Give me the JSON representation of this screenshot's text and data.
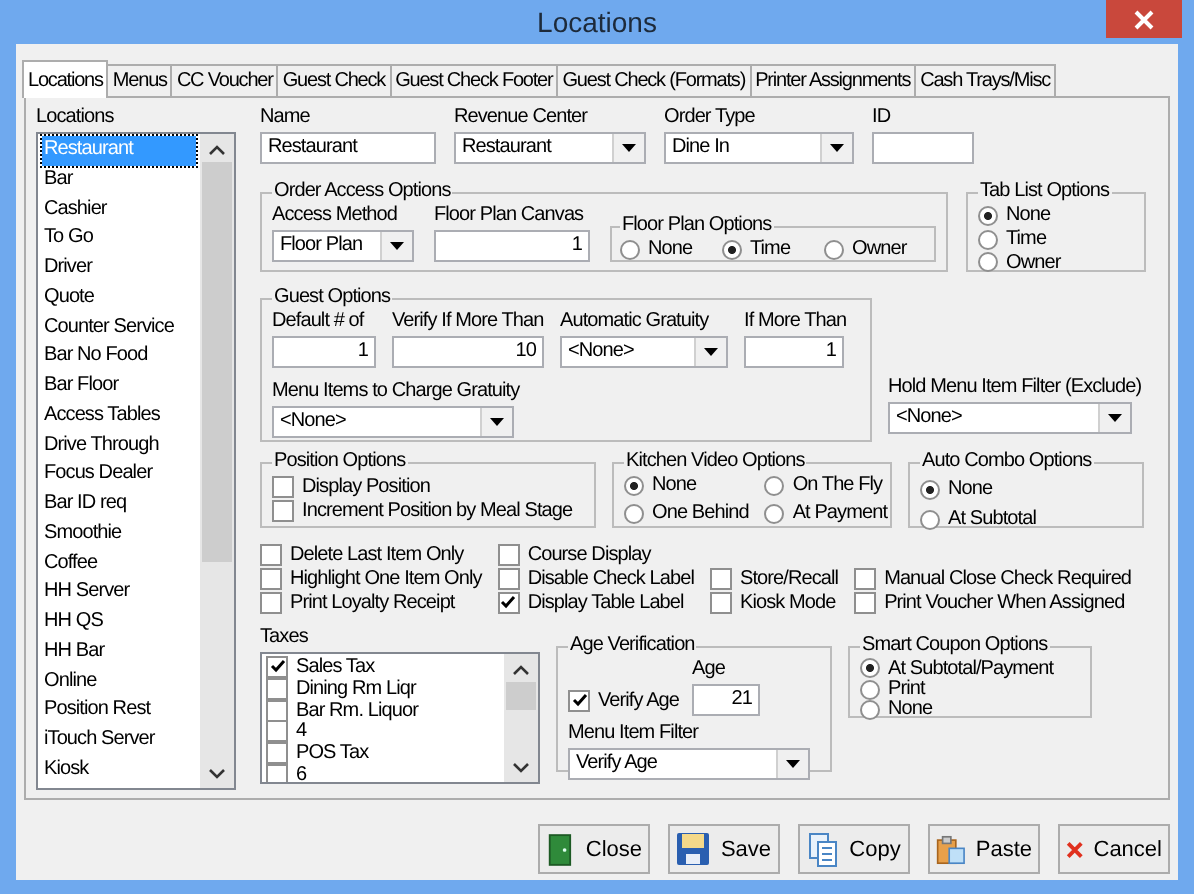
{
  "window": {
    "title": "Locations"
  },
  "tabs": [
    {
      "label": "Locations",
      "selected": true
    },
    {
      "label": "Menus",
      "selected": false
    },
    {
      "label": "CC Voucher",
      "selected": false
    },
    {
      "label": "Guest Check",
      "selected": false
    },
    {
      "label": "Guest Check Footer",
      "selected": false
    },
    {
      "label": "Guest Check (Formats)",
      "selected": false
    },
    {
      "label": "Printer Assignments",
      "selected": false
    },
    {
      "label": "Cash Trays/Misc",
      "selected": false
    }
  ],
  "locations": {
    "label": "Locations",
    "items": [
      {
        "label": "Restaurant",
        "selected": true
      },
      {
        "label": "Bar",
        "selected": false
      },
      {
        "label": "Cashier",
        "selected": false
      },
      {
        "label": "To Go",
        "selected": false
      },
      {
        "label": "Driver",
        "selected": false
      },
      {
        "label": "Quote",
        "selected": false
      },
      {
        "label": "Counter Service",
        "selected": false
      },
      {
        "label": "Bar No Food",
        "selected": false
      },
      {
        "label": "Bar Floor",
        "selected": false
      },
      {
        "label": "Access Tables",
        "selected": false
      },
      {
        "label": "Drive Through",
        "selected": false
      },
      {
        "label": "Focus Dealer",
        "selected": false
      },
      {
        "label": "Bar ID req",
        "selected": false
      },
      {
        "label": "Smoothie",
        "selected": false
      },
      {
        "label": "Coffee",
        "selected": false
      },
      {
        "label": "HH Server",
        "selected": false
      },
      {
        "label": "HH QS",
        "selected": false
      },
      {
        "label": "HH Bar",
        "selected": false
      },
      {
        "label": "Online",
        "selected": false
      },
      {
        "label": "Position Rest",
        "selected": false
      },
      {
        "label": "iTouch Server",
        "selected": false
      },
      {
        "label": "Kiosk",
        "selected": false
      }
    ]
  },
  "name": {
    "label": "Name",
    "value": "Restaurant"
  },
  "revenue_center": {
    "label": "Revenue Center",
    "value": "Restaurant"
  },
  "order_type": {
    "label": "Order Type",
    "value": "Dine In"
  },
  "id": {
    "label": "ID"
  },
  "order_access_options": {
    "title": "Order Access Options",
    "access_method": {
      "label": "Access Method",
      "value": "Floor Plan"
    },
    "floor_plan_canvas": {
      "label": "Floor Plan Canvas",
      "value": "1"
    },
    "floor_plan_options": {
      "title": "Floor Plan Options",
      "options": [
        {
          "label": "None",
          "selected": false
        },
        {
          "label": "Time",
          "selected": true
        },
        {
          "label": "Owner",
          "selected": false
        }
      ]
    }
  },
  "tab_list_options": {
    "title": "Tab List Options",
    "options": [
      {
        "label": "None",
        "selected": true
      },
      {
        "label": "Time",
        "selected": false
      },
      {
        "label": "Owner",
        "selected": false
      }
    ]
  },
  "guest_options": {
    "title": "Guest Options",
    "default_count": {
      "label": "Default # of",
      "value": "1"
    },
    "verify_if_more_than": {
      "label": "Verify If More Than",
      "value": "10"
    },
    "automatic_gratuity": {
      "label": "Automatic Gratuity",
      "value": "<None>"
    },
    "if_more_than": {
      "label": "If More Than",
      "value": "1"
    },
    "menu_items_to_charge_gratuity": {
      "label": "Menu Items to Charge Gratuity",
      "value": "<None>"
    }
  },
  "hold_menu_item_filter": {
    "label": "Hold Menu Item Filter (Exclude)",
    "value": "<None>"
  },
  "position_options": {
    "title": "Position Options",
    "options": [
      {
        "label": "Display Position",
        "checked": false
      },
      {
        "label": "Increment Position by Meal Stage",
        "checked": false
      }
    ]
  },
  "kitchen_video_options": {
    "title": "Kitchen Video Options",
    "options": [
      {
        "label": "None",
        "selected": true
      },
      {
        "label": "On The Fly",
        "selected": false
      },
      {
        "label": "One Behind",
        "selected": false
      },
      {
        "label": "At Payment",
        "selected": false
      }
    ]
  },
  "auto_combo_options": {
    "title": "Auto Combo Options",
    "options": [
      {
        "label": "None",
        "selected": true
      },
      {
        "label": "At Subtotal",
        "selected": false
      }
    ]
  },
  "check_options": [
    [
      {
        "label": "Delete Last Item Only",
        "checked": false
      },
      {
        "label": "Course Display",
        "checked": false
      }
    ],
    [
      {
        "label": "Highlight One Item Only",
        "checked": false
      },
      {
        "label": "Disable Check Label",
        "checked": false
      },
      {
        "label": "Store/Recall",
        "checked": false
      },
      {
        "label": "Manual Close Check Required",
        "checked": false
      }
    ],
    [
      {
        "label": "Print Loyalty Receipt",
        "checked": false
      },
      {
        "label": "Display Table Label",
        "checked": true
      },
      {
        "label": "Kiosk Mode",
        "checked": false
      },
      {
        "label": "Print Voucher When Assigned",
        "checked": false
      }
    ]
  ],
  "taxes": {
    "label": "Taxes",
    "items": [
      {
        "label": "Sales Tax",
        "checked": true
      },
      {
        "label": "Dining Rm Liqr",
        "checked": false
      },
      {
        "label": "Bar Rm. Liquor",
        "checked": false
      },
      {
        "label": "4",
        "checked": false
      },
      {
        "label": "POS Tax",
        "checked": false
      },
      {
        "label": "6",
        "checked": false
      }
    ]
  },
  "age_verification": {
    "title": "Age Verification",
    "verify_age": {
      "label": "Verify Age",
      "checked": true
    },
    "age": {
      "label": "Age",
      "value": "21"
    },
    "menu_item_filter": {
      "label": "Menu Item Filter",
      "value": "Verify Age"
    }
  },
  "smart_coupon_options": {
    "title": "Smart Coupon Options",
    "options": [
      {
        "label": "At Subtotal/Payment",
        "selected": true
      },
      {
        "label": "Print",
        "selected": false
      },
      {
        "label": "None",
        "selected": false
      }
    ]
  },
  "buttons": [
    {
      "label": "Close",
      "kind": "close"
    },
    {
      "label": "Save",
      "kind": "save"
    },
    {
      "label": "Copy",
      "kind": "copy"
    },
    {
      "label": "Paste",
      "kind": "paste"
    },
    {
      "label": "Cancel",
      "kind": "cancel"
    }
  ]
}
